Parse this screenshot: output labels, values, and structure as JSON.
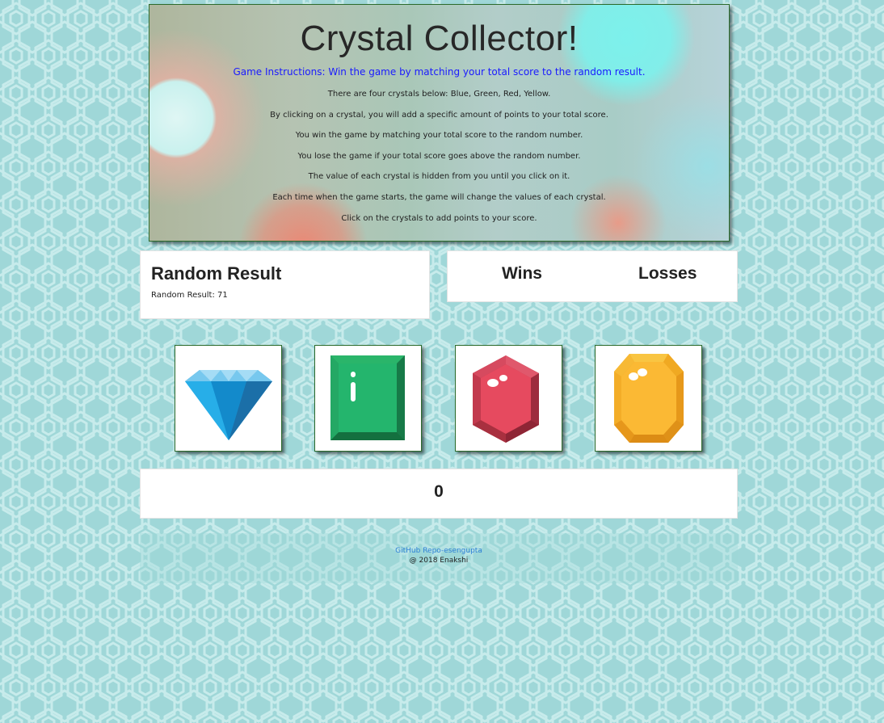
{
  "banner": {
    "title": "Crystal Collector!",
    "instructions": "Game Instructions: Win the game by matching your total score to the random result.",
    "rules": [
      "There are four crystals below: Blue, Green, Red, Yellow.",
      "By clicking on a crystal, you will add a specific amount of points to your total score.",
      "You win the game by matching your total score to the random number.",
      "You lose the game if your total score goes above the random number.",
      "The value of each crystal is hidden from you until you click on it.",
      "Each time when the game starts, the game will change the values of each crystal.",
      "Click on the crystals to add points to your score."
    ]
  },
  "random_result": {
    "heading": "Random Result",
    "text": "Random Result: 71"
  },
  "stats": {
    "wins_label": "Wins",
    "losses_label": "Losses"
  },
  "crystals": [
    {
      "icon": "blue-diamond-icon",
      "color": "#1aa3e0"
    },
    {
      "icon": "green-emerald-icon",
      "color": "#1fa462"
    },
    {
      "icon": "red-ruby-icon",
      "color": "#d8485c"
    },
    {
      "icon": "yellow-topaz-icon",
      "color": "#f7b731"
    }
  ],
  "total_score": "0",
  "footer": {
    "link_text": "GitHub Repo-esengupta",
    "copyright": "@ 2018 Enakshi"
  }
}
